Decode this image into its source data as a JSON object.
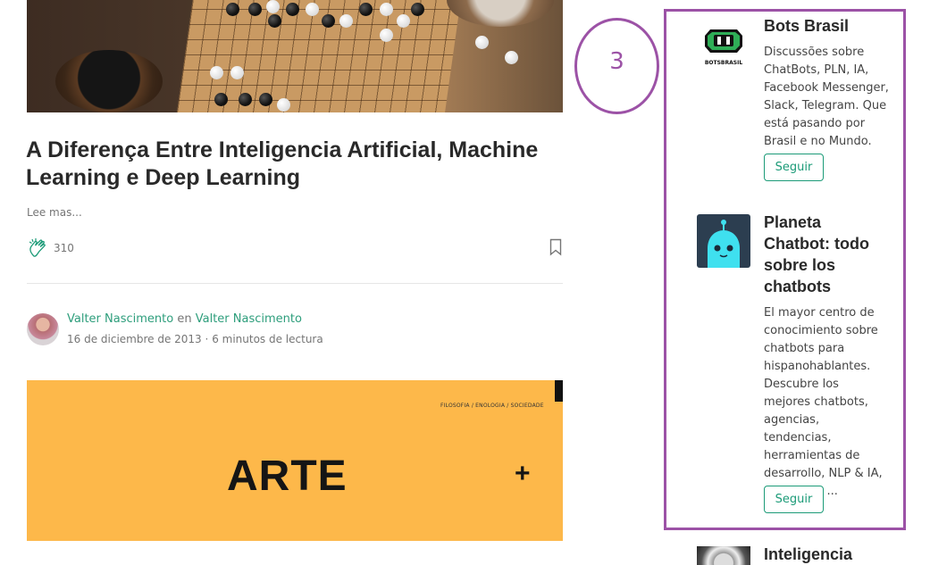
{
  "post1": {
    "title": "A Diferença Entre Inteligencia Artificial, Machine Learning e Deep Learning",
    "read_more": "Lee mas...",
    "claps": "310"
  },
  "post2": {
    "author": "Valter Nascimento",
    "connector": "en",
    "publication": "Valter Nascimento",
    "date": "16 de diciembre de 2013",
    "separator": "·",
    "read_time": "6 minutos de lectura",
    "image_tags": "FILOSOFIA / ENOLOGIA / SOCIEDADE",
    "image_title": "ARTE",
    "image_plus": "+"
  },
  "annotation": {
    "number": "3",
    "color": "#9c52a6"
  },
  "sidebar": {
    "publications": [
      {
        "name": "Bots Brasil",
        "logo_text": "BOTSBRASIL",
        "description": "Discussões sobre ChatBots, PLN, IA, Facebook Messenger, Slack, Telegram. Que está pasando por Brasil e no Mundo.",
        "follow_label": "Seguir"
      },
      {
        "name": "Planeta Chatbot: todo sobre los chatbots",
        "description": "El mayor centro de conocimiento sobre chatbots para hispanohablantes. Descubre los mejores chatbots, agencias, tendencias, herramientas de desarrollo, NLP & IA, normativa ...",
        "follow_label": "Seguir"
      },
      {
        "name": "Inteligencia"
      }
    ]
  },
  "colors": {
    "accent": "#1c9b78",
    "link": "#2e9e7c",
    "banner": "#fdb84a"
  }
}
